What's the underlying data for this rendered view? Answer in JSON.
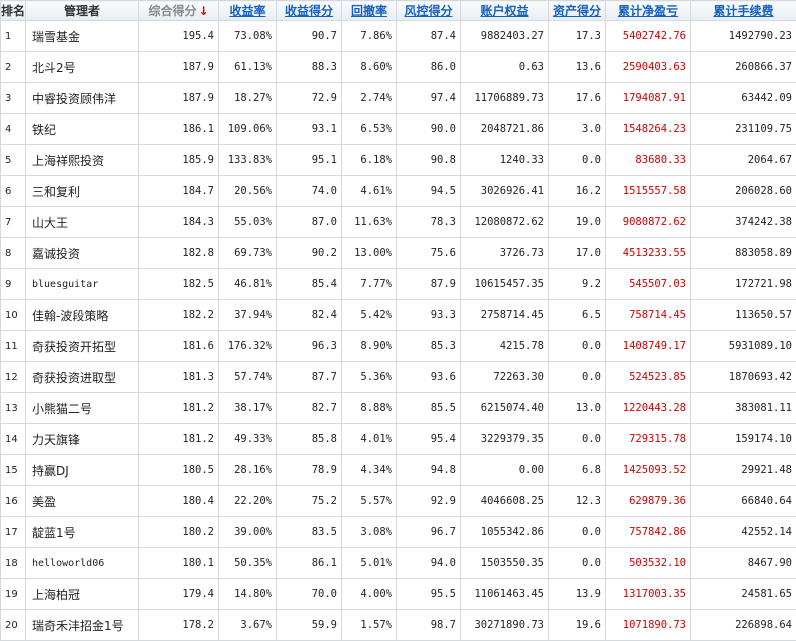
{
  "table": {
    "headers": {
      "rank": "排名",
      "manager": "管理者",
      "score": "综合得分",
      "return_rate": "收益率",
      "return_score": "收益得分",
      "drawdown": "回撤率",
      "risk_score": "风控得分",
      "equity": "账户权益",
      "asset_score": "资产得分",
      "net_pnl": "累计净盈亏",
      "fees": "累计手续费"
    },
    "sort_indicator": "↓",
    "rows": [
      {
        "rank": "1",
        "manager": "瑞雪基金",
        "score": "195.4",
        "return_rate": "73.08%",
        "return_score": "90.7",
        "drawdown": "7.86%",
        "risk_score": "87.4",
        "equity": "9882403.27",
        "asset_score": "17.3",
        "net_pnl": "5402742.76",
        "fees": "1492790.23"
      },
      {
        "rank": "2",
        "manager": "北斗2号",
        "score": "187.9",
        "return_rate": "61.13%",
        "return_score": "88.3",
        "drawdown": "8.60%",
        "risk_score": "86.0",
        "equity": "0.63",
        "asset_score": "13.6",
        "net_pnl": "2590403.63",
        "fees": "260866.37"
      },
      {
        "rank": "3",
        "manager": "中睿投资顾伟洋",
        "score": "187.9",
        "return_rate": "18.27%",
        "return_score": "72.9",
        "drawdown": "2.74%",
        "risk_score": "97.4",
        "equity": "11706889.73",
        "asset_score": "17.6",
        "net_pnl": "1794087.91",
        "fees": "63442.09"
      },
      {
        "rank": "4",
        "manager": "铁纪",
        "score": "186.1",
        "return_rate": "109.06%",
        "return_score": "93.1",
        "drawdown": "6.53%",
        "risk_score": "90.0",
        "equity": "2048721.86",
        "asset_score": "3.0",
        "net_pnl": "1548264.23",
        "fees": "231109.75"
      },
      {
        "rank": "5",
        "manager": "上海祥熙投资",
        "score": "185.9",
        "return_rate": "133.83%",
        "return_score": "95.1",
        "drawdown": "6.18%",
        "risk_score": "90.8",
        "equity": "1240.33",
        "asset_score": "0.0",
        "net_pnl": "83680.33",
        "fees": "2064.67"
      },
      {
        "rank": "6",
        "manager": "三和复利",
        "score": "184.7",
        "return_rate": "20.56%",
        "return_score": "74.0",
        "drawdown": "4.61%",
        "risk_score": "94.5",
        "equity": "3026926.41",
        "asset_score": "16.2",
        "net_pnl": "1515557.58",
        "fees": "206028.60"
      },
      {
        "rank": "7",
        "manager": "山大王",
        "score": "184.3",
        "return_rate": "55.03%",
        "return_score": "87.0",
        "drawdown": "11.63%",
        "risk_score": "78.3",
        "equity": "12080872.62",
        "asset_score": "19.0",
        "net_pnl": "9080872.62",
        "fees": "374242.38"
      },
      {
        "rank": "8",
        "manager": "嘉诚投资",
        "score": "182.8",
        "return_rate": "69.73%",
        "return_score": "90.2",
        "drawdown": "13.00%",
        "risk_score": "75.6",
        "equity": "3726.73",
        "asset_score": "17.0",
        "net_pnl": "4513233.55",
        "fees": "883058.89"
      },
      {
        "rank": "9",
        "manager": "bluesguitar",
        "score": "182.5",
        "return_rate": "46.81%",
        "return_score": "85.4",
        "drawdown": "7.77%",
        "risk_score": "87.9",
        "equity": "10615457.35",
        "asset_score": "9.2",
        "net_pnl": "545507.03",
        "fees": "172721.98"
      },
      {
        "rank": "10",
        "manager": "佳翰-波段策略",
        "score": "182.2",
        "return_rate": "37.94%",
        "return_score": "82.4",
        "drawdown": "5.42%",
        "risk_score": "93.3",
        "equity": "2758714.45",
        "asset_score": "6.5",
        "net_pnl": "758714.45",
        "fees": "113650.57"
      },
      {
        "rank": "11",
        "manager": "奇获投资开拓型",
        "score": "181.6",
        "return_rate": "176.32%",
        "return_score": "96.3",
        "drawdown": "8.90%",
        "risk_score": "85.3",
        "equity": "4215.78",
        "asset_score": "0.0",
        "net_pnl": "1408749.17",
        "fees": "5931089.10"
      },
      {
        "rank": "12",
        "manager": "奇获投资进取型",
        "score": "181.3",
        "return_rate": "57.74%",
        "return_score": "87.7",
        "drawdown": "5.36%",
        "risk_score": "93.6",
        "equity": "72263.30",
        "asset_score": "0.0",
        "net_pnl": "524523.85",
        "fees": "1870693.42"
      },
      {
        "rank": "13",
        "manager": "小熊猫二号",
        "score": "181.2",
        "return_rate": "38.17%",
        "return_score": "82.7",
        "drawdown": "8.88%",
        "risk_score": "85.5",
        "equity": "6215074.40",
        "asset_score": "13.0",
        "net_pnl": "1220443.28",
        "fees": "383081.11"
      },
      {
        "rank": "14",
        "manager": "力天旗锋",
        "score": "181.2",
        "return_rate": "49.33%",
        "return_score": "85.8",
        "drawdown": "4.01%",
        "risk_score": "95.4",
        "equity": "3229379.35",
        "asset_score": "0.0",
        "net_pnl": "729315.78",
        "fees": "159174.10"
      },
      {
        "rank": "15",
        "manager": "持赢DJ",
        "score": "180.5",
        "return_rate": "28.16%",
        "return_score": "78.9",
        "drawdown": "4.34%",
        "risk_score": "94.8",
        "equity": "0.00",
        "asset_score": "6.8",
        "net_pnl": "1425093.52",
        "fees": "29921.48"
      },
      {
        "rank": "16",
        "manager": "美盈",
        "score": "180.4",
        "return_rate": "22.20%",
        "return_score": "75.2",
        "drawdown": "5.57%",
        "risk_score": "92.9",
        "equity": "4046608.25",
        "asset_score": "12.3",
        "net_pnl": "629879.36",
        "fees": "66840.64"
      },
      {
        "rank": "17",
        "manager": "靛蓝1号",
        "score": "180.2",
        "return_rate": "39.00%",
        "return_score": "83.5",
        "drawdown": "3.08%",
        "risk_score": "96.7",
        "equity": "1055342.86",
        "asset_score": "0.0",
        "net_pnl": "757842.86",
        "fees": "42552.14"
      },
      {
        "rank": "18",
        "manager": "helloworld06",
        "score": "180.1",
        "return_rate": "50.35%",
        "return_score": "86.1",
        "drawdown": "5.01%",
        "risk_score": "94.0",
        "equity": "1503550.35",
        "asset_score": "0.0",
        "net_pnl": "503532.10",
        "fees": "8467.90"
      },
      {
        "rank": "19",
        "manager": "上海柏冠",
        "score": "179.4",
        "return_rate": "14.80%",
        "return_score": "70.0",
        "drawdown": "4.00%",
        "risk_score": "95.5",
        "equity": "11061463.45",
        "asset_score": "13.9",
        "net_pnl": "1317003.35",
        "fees": "24581.65"
      },
      {
        "rank": "20",
        "manager": "瑞奇禾沣招金1号",
        "score": "178.2",
        "return_rate": "3.67%",
        "return_score": "59.9",
        "drawdown": "1.57%",
        "risk_score": "98.7",
        "equity": "30271890.73",
        "asset_score": "19.6",
        "net_pnl": "1071890.73",
        "fees": "226898.64"
      }
    ]
  }
}
